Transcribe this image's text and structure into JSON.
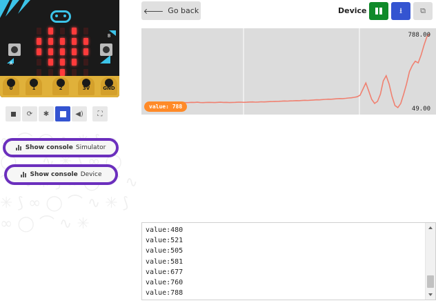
{
  "simulator": {
    "pins": [
      "0",
      "1",
      "2",
      "3V",
      "GND"
    ],
    "button_a_label": "A",
    "button_b_label": "B",
    "led_matrix": [
      [
        0,
        1,
        0,
        1,
        0
      ],
      [
        1,
        1,
        1,
        1,
        1
      ],
      [
        1,
        1,
        1,
        1,
        1
      ],
      [
        0,
        1,
        1,
        1,
        0
      ],
      [
        0,
        0,
        1,
        0,
        0
      ]
    ],
    "toolbar": [
      "stop-icon",
      "restart-icon",
      "debug-icon",
      "fullscreen-square-icon",
      "mute-icon",
      "screenshot-icon"
    ]
  },
  "console_buttons": {
    "simulator": {
      "label": "Show console",
      "target": "Simulator"
    },
    "device": {
      "label": "Show console",
      "target": "Device"
    }
  },
  "header": {
    "go_back": "Go back",
    "title": "Device"
  },
  "chart_data": {
    "type": "line",
    "max_label": "788.00",
    "min_label": "49.00",
    "badge": "value: 788",
    "color": "#f08070",
    "ylim": [
      49,
      788
    ],
    "values": [
      120,
      118,
      119,
      121,
      120,
      122,
      119,
      118,
      120,
      121,
      120,
      119,
      121,
      122,
      120,
      121,
      119,
      120,
      121,
      122,
      123,
      121,
      122,
      124,
      125,
      123,
      124,
      126,
      125,
      127,
      128,
      129,
      130,
      131,
      132,
      134,
      133,
      135,
      136,
      138,
      137,
      139,
      141,
      140,
      142,
      144,
      146,
      145,
      148,
      150,
      152,
      151,
      154,
      156,
      158,
      157,
      160,
      163,
      165,
      170,
      175,
      190,
      250,
      310,
      230,
      150,
      110,
      130,
      200,
      330,
      380,
      300,
      180,
      90,
      70,
      110,
      200,
      300,
      420,
      480,
      521,
      505,
      581,
      677,
      760,
      788
    ]
  },
  "console": {
    "lines": [
      "value:480",
      "value:521",
      "value:505",
      "value:581",
      "value:677",
      "value:760",
      "value:788"
    ]
  },
  "colors": {
    "accent_purple": "#6b2fbd",
    "blue": "#3454d1",
    "green": "#108a2a",
    "orange": "#ff8a28"
  }
}
